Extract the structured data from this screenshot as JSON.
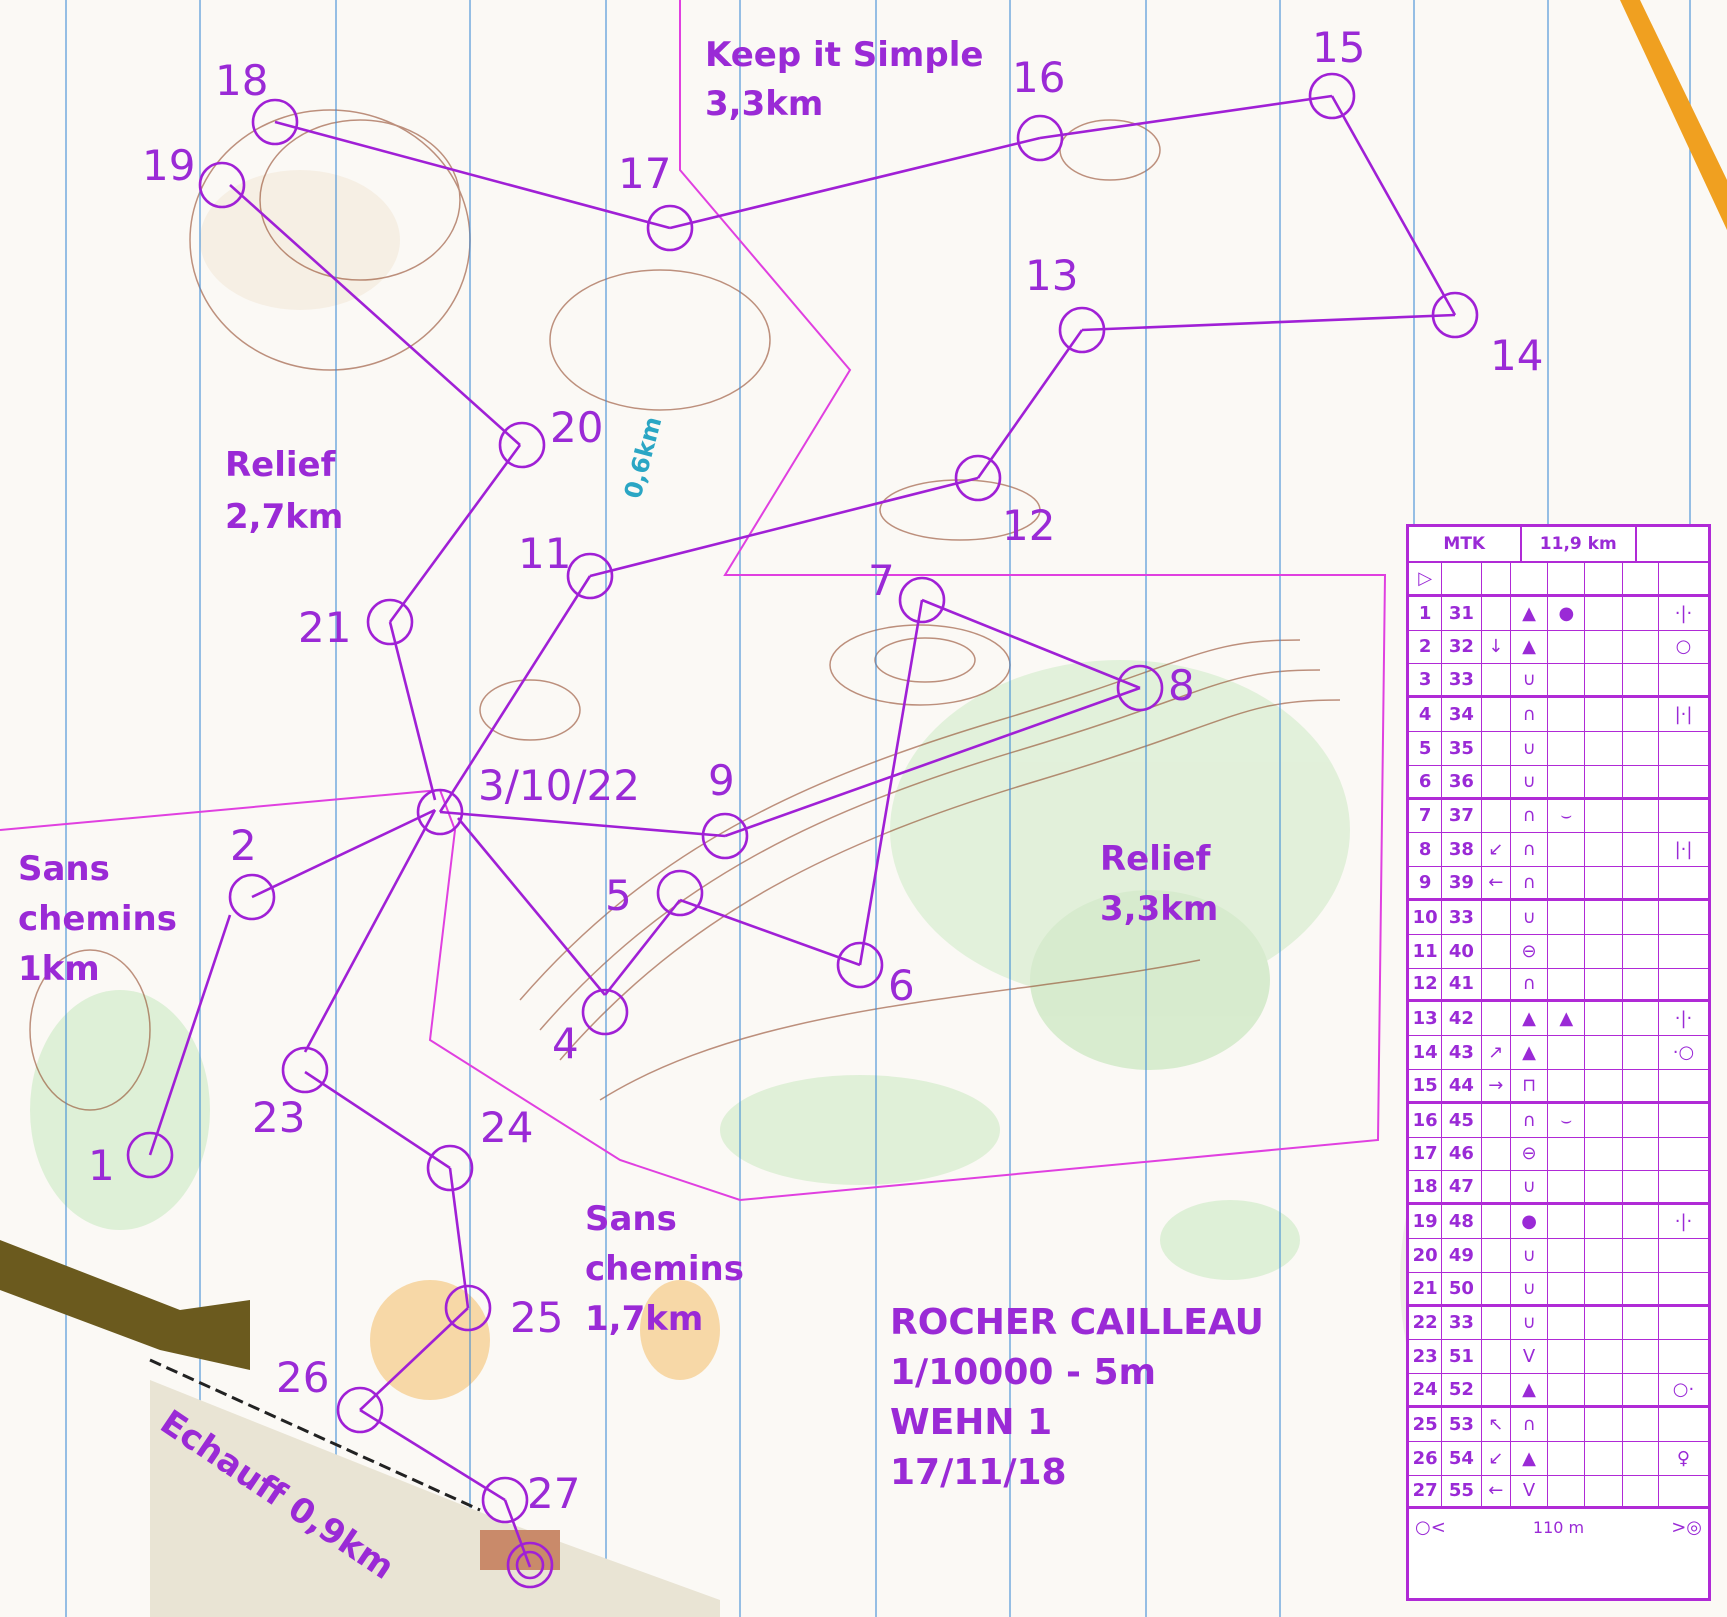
{
  "course": {
    "title_lines": [
      "ROCHER CAILLEAU",
      "1/10000 - 5m",
      "WEHN 1",
      "17/11/18"
    ]
  },
  "zones": [
    {
      "id": "keep-it-simple",
      "lines": [
        "Keep it Simple",
        "3,3km"
      ]
    },
    {
      "id": "relief-left",
      "lines": [
        "Relief",
        "2,7km"
      ]
    },
    {
      "id": "relief-right",
      "lines": [
        "Relief",
        "3,3km"
      ]
    },
    {
      "id": "sans-chemins-left",
      "lines": [
        "Sans",
        "chemins",
        "1km"
      ]
    },
    {
      "id": "sans-chemins-right",
      "lines": [
        "Sans",
        "chemins",
        "1,7km"
      ]
    },
    {
      "id": "echauff",
      "lines": [
        "Echauff 0,9km"
      ]
    },
    {
      "id": "leg-length",
      "lines": [
        "0,6km"
      ]
    }
  ],
  "controls": [
    {
      "label": "1"
    },
    {
      "label": "2"
    },
    {
      "label": "3/10/22"
    },
    {
      "label": "4"
    },
    {
      "label": "5"
    },
    {
      "label": "6"
    },
    {
      "label": "7"
    },
    {
      "label": "8"
    },
    {
      "label": "9"
    },
    {
      "label": "11"
    },
    {
      "label": "12"
    },
    {
      "label": "13"
    },
    {
      "label": "14"
    },
    {
      "label": "15"
    },
    {
      "label": "16"
    },
    {
      "label": "17"
    },
    {
      "label": "18"
    },
    {
      "label": "19"
    },
    {
      "label": "20"
    },
    {
      "label": "21"
    },
    {
      "label": "23"
    },
    {
      "label": "24"
    },
    {
      "label": "25"
    },
    {
      "label": "26"
    },
    {
      "label": "27"
    }
  ],
  "description_sheet": {
    "event": "MTK",
    "length": "11,9 km",
    "footer_distance": "110 m",
    "rows": [
      {
        "num": "1",
        "code": "31",
        "dir": "",
        "feature": "▲",
        "detail": "●",
        "extra": "·|·"
      },
      {
        "num": "2",
        "code": "32",
        "dir": "↓",
        "feature": "▲",
        "detail": "",
        "extra": "○"
      },
      {
        "num": "3",
        "code": "33",
        "dir": "",
        "feature": "∪",
        "detail": "",
        "extra": ""
      },
      {
        "num": "4",
        "code": "34",
        "dir": "",
        "feature": "∩",
        "detail": "",
        "extra": "|·|"
      },
      {
        "num": "5",
        "code": "35",
        "dir": "",
        "feature": "∪",
        "detail": "",
        "extra": ""
      },
      {
        "num": "6",
        "code": "36",
        "dir": "",
        "feature": "∪",
        "detail": "",
        "extra": ""
      },
      {
        "num": "7",
        "code": "37",
        "dir": "",
        "feature": "∩",
        "detail": "⌣",
        "extra": ""
      },
      {
        "num": "8",
        "code": "38",
        "dir": "↙",
        "feature": "∩",
        "detail": "",
        "extra": "|·|"
      },
      {
        "num": "9",
        "code": "39",
        "dir": "←",
        "feature": "∩",
        "detail": "",
        "extra": ""
      },
      {
        "num": "10",
        "code": "33",
        "dir": "",
        "feature": "∪",
        "detail": "",
        "extra": ""
      },
      {
        "num": "11",
        "code": "40",
        "dir": "",
        "feature": "⊖",
        "detail": "",
        "extra": ""
      },
      {
        "num": "12",
        "code": "41",
        "dir": "",
        "feature": "∩",
        "detail": "",
        "extra": ""
      },
      {
        "num": "13",
        "code": "42",
        "dir": "",
        "feature": "▲",
        "detail": "▲",
        "extra": "·|·"
      },
      {
        "num": "14",
        "code": "43",
        "dir": "↗",
        "feature": "▲",
        "detail": "",
        "extra": "·○"
      },
      {
        "num": "15",
        "code": "44",
        "dir": "→",
        "feature": "⊓",
        "detail": "",
        "extra": ""
      },
      {
        "num": "16",
        "code": "45",
        "dir": "",
        "feature": "∩",
        "detail": "⌣",
        "extra": ""
      },
      {
        "num": "17",
        "code": "46",
        "dir": "",
        "feature": "⊖",
        "detail": "",
        "extra": ""
      },
      {
        "num": "18",
        "code": "47",
        "dir": "",
        "feature": "∪",
        "detail": "",
        "extra": ""
      },
      {
        "num": "19",
        "code": "48",
        "dir": "",
        "feature": "●",
        "detail": "",
        "extra": "·|·"
      },
      {
        "num": "20",
        "code": "49",
        "dir": "",
        "feature": "∪",
        "detail": "",
        "extra": ""
      },
      {
        "num": "21",
        "code": "50",
        "dir": "",
        "feature": "∪",
        "detail": "",
        "extra": ""
      },
      {
        "num": "22",
        "code": "33",
        "dir": "",
        "feature": "∪",
        "detail": "",
        "extra": ""
      },
      {
        "num": "23",
        "code": "51",
        "dir": "",
        "feature": "V",
        "detail": "",
        "extra": ""
      },
      {
        "num": "24",
        "code": "52",
        "dir": "",
        "feature": "▲",
        "detail": "",
        "extra": "○·"
      },
      {
        "num": "25",
        "code": "53",
        "dir": "↖",
        "feature": "∩",
        "detail": "",
        "extra": ""
      },
      {
        "num": "26",
        "code": "54",
        "dir": "↙",
        "feature": "▲",
        "detail": "",
        "extra": "♀"
      },
      {
        "num": "27",
        "code": "55",
        "dir": "←",
        "feature": "V",
        "detail": "",
        "extra": ""
      }
    ]
  }
}
